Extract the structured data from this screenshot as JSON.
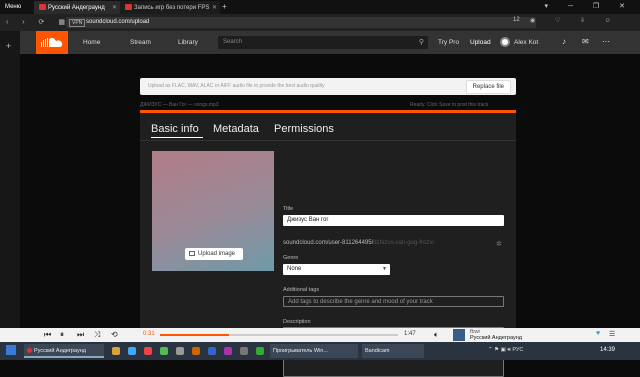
{
  "browser": {
    "menu_label": "Меню",
    "tabs": [
      {
        "label": "Русский Андеграунд"
      },
      {
        "label": "Запись игр без потери FPS"
      }
    ],
    "url": "soundcloud.com/upload",
    "vpn": "VPN",
    "badge": "12"
  },
  "header": {
    "nav": [
      "Home",
      "Stream",
      "Library"
    ],
    "search_placeholder": "Search",
    "try_pro": "Try Pro",
    "upload": "Upload",
    "username": "Alex Kot"
  },
  "upload": {
    "hint": "Upload as FLAC, WAV, ALAC or AIFF audio file to provide the best audio quality",
    "replace_label": "Replace file",
    "file_name": "ДЖИЗУС — Ван Гог — songs.mp3",
    "status": "Ready. Click Save to post this track",
    "progress": 1.0
  },
  "form": {
    "tabs": [
      "Basic info",
      "Metadata",
      "Permissions"
    ],
    "active_tab": "Basic info",
    "upload_image_label": "Upload image",
    "title_label": "Title",
    "title_value": "Джизус Ван гог",
    "permalink_prefix": "soundcloud.com/user-811264495/",
    "permalink_slug": "dzhizus-van-gog-frozvi",
    "genre_label": "Genre",
    "genre_value": "None",
    "tags_label": "Additional tags",
    "tags_placeholder": "Add tags to describe the genre and mood of your track",
    "desc_label": "Description",
    "desc_placeholder": "Describe your track"
  },
  "player": {
    "current_time": "0:31",
    "duration": "1:47",
    "progress": 0.29,
    "artist": "fbwi",
    "title": "Русский Андеграунд"
  },
  "taskbar": {
    "items": [
      {
        "label": "Русский Андеграунд"
      },
      {
        "label": "Проигрыватель Win..."
      },
      {
        "label": "Bandicam"
      }
    ],
    "lang": "РУС",
    "clock": "14:39"
  },
  "colors": {
    "accent": "#ff5500",
    "header": "#333333",
    "panel": "#1f1f1f"
  }
}
